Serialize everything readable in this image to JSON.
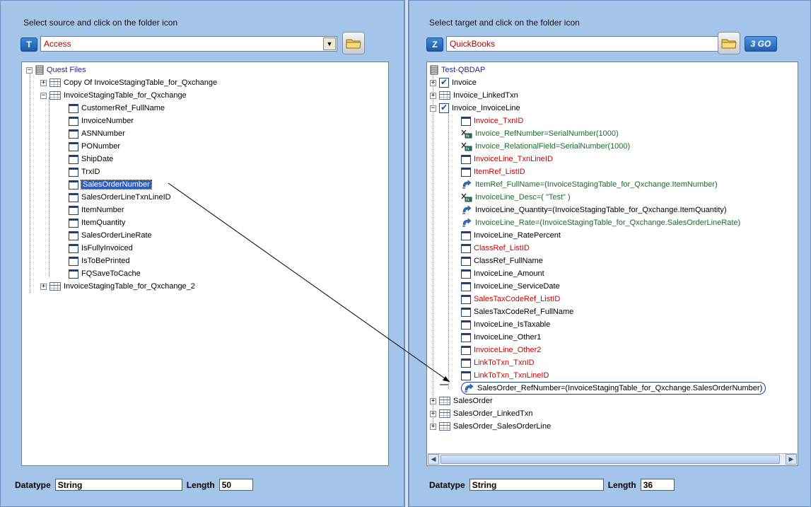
{
  "source": {
    "instruction": "Select source and click on the folder icon",
    "badge": "T",
    "selected": "Access",
    "tree": {
      "root": "Quest Files",
      "items": [
        {
          "label": "Copy Of InvoiceStagingTable_for_Qxchange"
        },
        {
          "label": "InvoiceStagingTable_for_Qxchange"
        },
        {
          "label": "CustomerRef_FullName"
        },
        {
          "label": "InvoiceNumber"
        },
        {
          "label": "ASNNumber"
        },
        {
          "label": "PONumber"
        },
        {
          "label": "ShipDate"
        },
        {
          "label": "TrxID"
        },
        {
          "label": "SalesOrderNumber"
        },
        {
          "label": "SalesOrderLineTxnLineID"
        },
        {
          "label": "ItemNumber"
        },
        {
          "label": "ItemQuantity"
        },
        {
          "label": "SalesOrderLineRate"
        },
        {
          "label": "IsFullyInvoiced"
        },
        {
          "label": "IsToBePrinted"
        },
        {
          "label": "FQSaveToCache"
        },
        {
          "label": "InvoiceStagingTable_for_Qxchange_2"
        }
      ]
    },
    "footer": {
      "datatype_label": "Datatype",
      "datatype": "String",
      "length_label": "Length",
      "length": "50"
    }
  },
  "target": {
    "instruction": "Select target and click on the folder icon",
    "badge": "Z",
    "selected": "QuickBooks",
    "go_label": "3 GO",
    "tree": {
      "root": "Test-QBDAP",
      "items": [
        {
          "label": "Invoice"
        },
        {
          "label": "Invoice_LinkedTxn"
        },
        {
          "label": "Invoice_InvoiceLine"
        },
        {
          "label": "Invoice_TxnID"
        },
        {
          "label": "Invoice_RefNumber=SerialNumber(1000)"
        },
        {
          "label": "Invoice_RelationalField=SerialNumber(1000)"
        },
        {
          "label": "InvoiceLine_TxnLineID"
        },
        {
          "label": "ItemRef_ListID"
        },
        {
          "label": "ItemRef_FullName=(InvoiceStagingTable_for_Qxchange.ItemNumber)"
        },
        {
          "label": "InvoiceLine_Desc=( \"Test\" )"
        },
        {
          "label": "InvoiceLine_Quantity=(InvoiceStagingTable_for_Qxchange.ItemQuantity)"
        },
        {
          "label": "InvoiceLine_Rate=(InvoiceStagingTable_for_Qxchange.SalesOrderLineRate)"
        },
        {
          "label": "InvoiceLine_RatePercent"
        },
        {
          "label": "ClassRef_ListID"
        },
        {
          "label": "ClassRef_FullName"
        },
        {
          "label": "InvoiceLine_Amount"
        },
        {
          "label": "InvoiceLine_ServiceDate"
        },
        {
          "label": "SalesTaxCodeRef_ListID"
        },
        {
          "label": "SalesTaxCodeRef_FullName"
        },
        {
          "label": "InvoiceLine_IsTaxable"
        },
        {
          "label": "InvoiceLine_Other1"
        },
        {
          "label": "InvoiceLine_Other2"
        },
        {
          "label": "LinkToTxn_TxnID"
        },
        {
          "label": "LinkToTxn_TxnLineID"
        },
        {
          "label": "SalesOrder_RefNumber=(InvoiceStagingTable_for_Qxchange.SalesOrderNumber)"
        },
        {
          "label": "SalesOrder"
        },
        {
          "label": "SalesOrder_LinkedTxn"
        },
        {
          "label": "SalesOrder_SalesOrderLine"
        }
      ]
    },
    "footer": {
      "datatype_label": "Datatype",
      "datatype": "String",
      "length_label": "Length",
      "length": "36"
    }
  },
  "colors": {
    "panel": "#a4c4ea",
    "required_field": "#c80000",
    "mapped_field": "#1d6a2b",
    "selection": "#2a5cc4"
  }
}
